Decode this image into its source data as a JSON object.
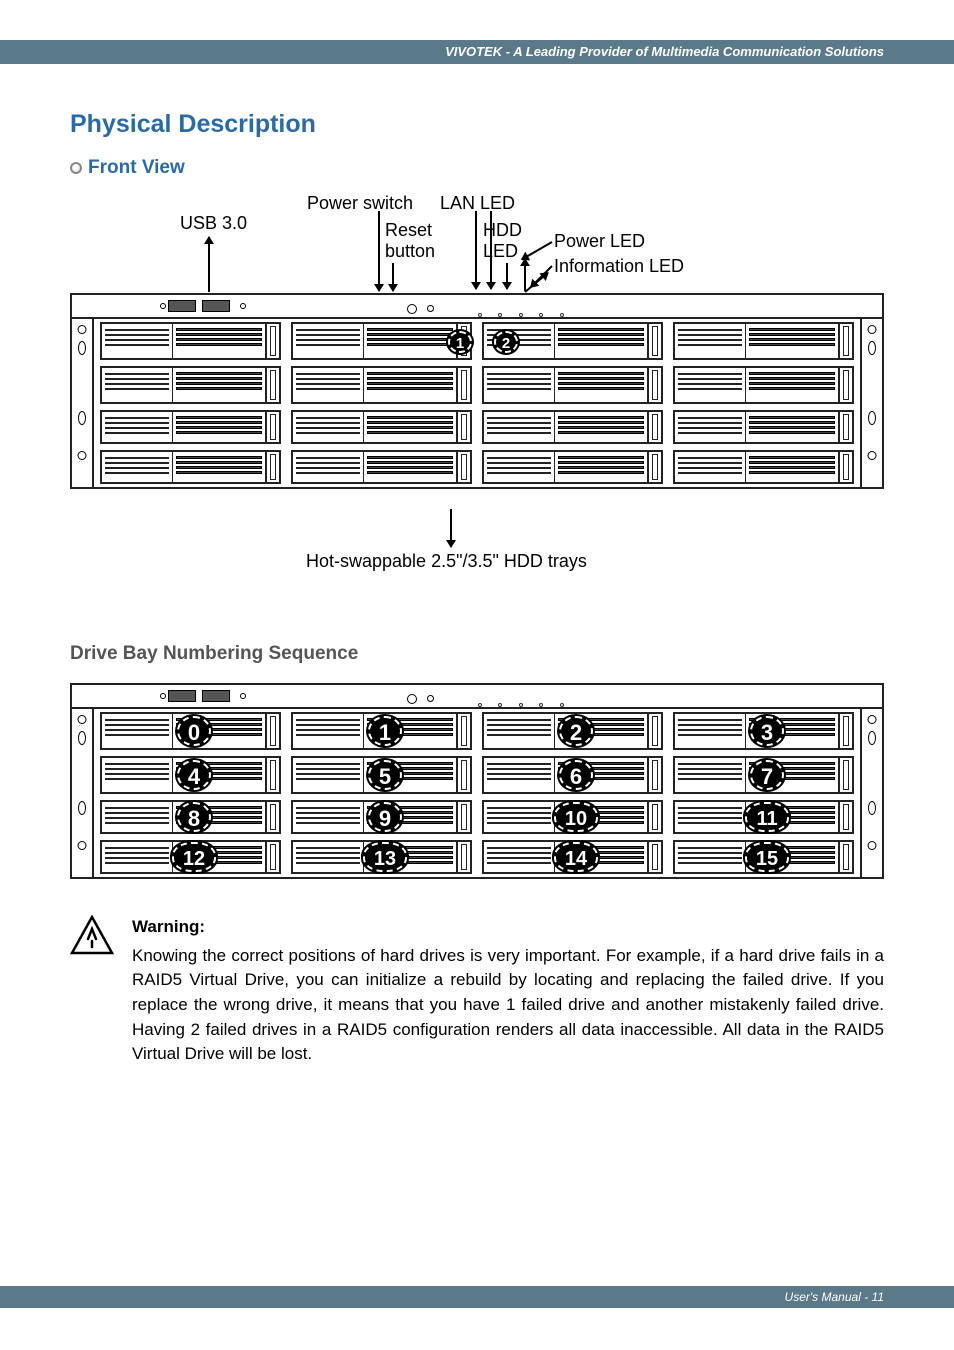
{
  "header": "VIVOTEK - A Leading Provider of Multimedia Communication Solutions",
  "title": "Physical Description",
  "section_front": "Front View",
  "labels": {
    "usb": "USB 3.0",
    "power_switch": "Power switch",
    "reset_l1": "Reset",
    "reset_l2": "button",
    "lan": "LAN LED",
    "hdd_l1": "HDD",
    "hdd_l2": "LED",
    "power_led": "Power LED",
    "info_led": "Information LED",
    "hotswap": "Hot-swappable 2.5\"/3.5\" HDD trays"
  },
  "front_badge_1": "1",
  "front_badge_2": "2",
  "section_numbering": "Drive Bay Numbering Sequence",
  "bays": [
    [
      "0",
      "1",
      "2",
      "3"
    ],
    [
      "4",
      "5",
      "6",
      "7"
    ],
    [
      "8",
      "9",
      "10",
      "11"
    ],
    [
      "12",
      "13",
      "14",
      "15"
    ]
  ],
  "warning_title": "Warning:",
  "warning_body": "Knowing the correct positions of hard drives is very important. For example, if a hard drive fails in a RAID5 Virtual Drive, you can initialize a rebuild by locating and replacing the failed drive. If you replace the wrong drive, it means that you have 1 failed drive and another mistakenly failed drive. Having 2 failed drives in a RAID5 configuration renders all data inaccessible. All data in the RAID5 Virtual Drive will be lost.",
  "footer": "User's Manual - 11"
}
